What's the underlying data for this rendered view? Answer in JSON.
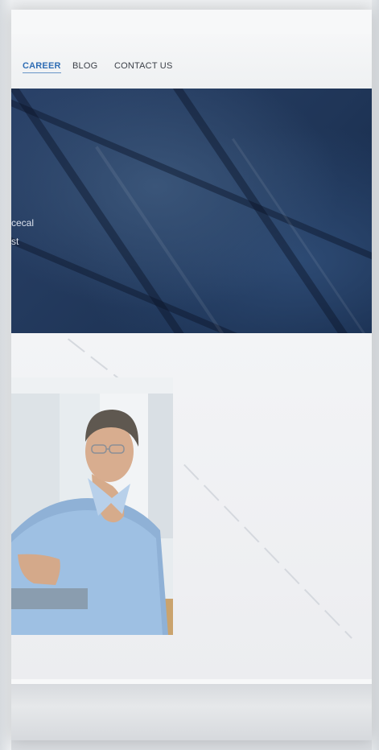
{
  "nav": {
    "items": [
      {
        "label": "CAREER",
        "active": true
      },
      {
        "label": "BLOG",
        "active": false
      },
      {
        "label": "CONTACT US",
        "active": false
      }
    ]
  },
  "hero": {
    "lines": [
      "cecal",
      "st"
    ]
  },
  "colors": {
    "accent": "#2f6db4",
    "hero_background": "#1f3557",
    "page_background": "#f7f8f9"
  }
}
